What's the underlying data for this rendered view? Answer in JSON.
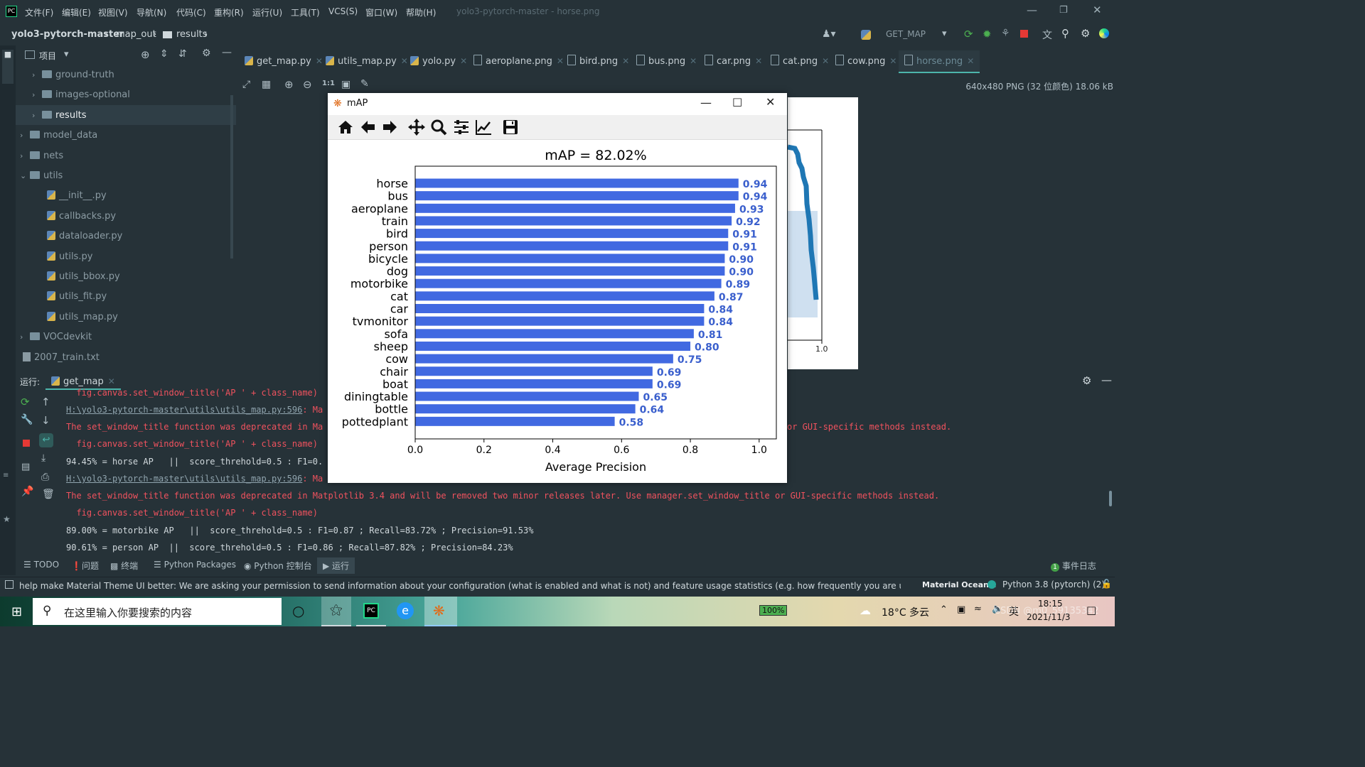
{
  "titlebar": {
    "menus": [
      "文件(F)",
      "编辑(E)",
      "视图(V)",
      "导航(N)",
      "代码(C)",
      "重构(R)",
      "运行(U)",
      "工具(T)",
      "VCS(S)",
      "窗口(W)",
      "帮助(H)"
    ],
    "title": "yolo3-pytorch-master - horse.png"
  },
  "breadcrumb": {
    "project": "yolo3-pytorch-master",
    "dir1": "map_out",
    "dir2": "results"
  },
  "run_config": "GET_MAP",
  "project_panel": {
    "label": "项目",
    "items": [
      {
        "name": "ground-truth",
        "type": "folder"
      },
      {
        "name": "images-optional",
        "type": "folder"
      },
      {
        "name": "results",
        "type": "folder"
      },
      {
        "name": "model_data",
        "type": "folder"
      },
      {
        "name": "nets",
        "type": "folder"
      },
      {
        "name": "utils",
        "type": "folder"
      },
      {
        "name": "__init__.py",
        "type": "py"
      },
      {
        "name": "callbacks.py",
        "type": "py"
      },
      {
        "name": "dataloader.py",
        "type": "py"
      },
      {
        "name": "utils.py",
        "type": "py"
      },
      {
        "name": "utils_bbox.py",
        "type": "py"
      },
      {
        "name": "utils_fit.py",
        "type": "py"
      },
      {
        "name": "utils_map.py",
        "type": "py"
      },
      {
        "name": "VOCdevkit",
        "type": "folder"
      },
      {
        "name": "2007_train.txt",
        "type": "txt"
      }
    ]
  },
  "tabs": [
    "get_map.py",
    "utils_map.py",
    "yolo.py",
    "aeroplane.png",
    "bird.png",
    "bus.png",
    "car.png",
    "cat.png",
    "cow.png",
    "horse.png"
  ],
  "image_info": "640x480 PNG (32 位颜色) 18.06 kB",
  "image_behind": {
    "tick": "1.0"
  },
  "run_panel": {
    "label": "运行:",
    "tab": "get_map",
    "lines": [
      {
        "text": "  fig.canvas.set_window_title('AP ' + class_name)",
        "style": "red"
      },
      {
        "text": "H:\\yolo3-pytorch-master\\utils\\utils_map.py:596",
        "style": "link",
        "suffix": ": Ma"
      },
      {
        "text": "The set_window_title function was deprecated in Ma",
        "style": "red",
        "right": "or GUI-specific methods instead."
      },
      {
        "text": "  fig.canvas.set_window_title('AP ' + class_name)",
        "style": "red"
      },
      {
        "text": "94.45% = horse AP   ||  score_threhold=0.5 : F1=0.",
        "style": "white"
      },
      {
        "text": "H:\\yolo3-pytorch-master\\utils\\utils_map.py:596",
        "style": "link",
        "suffix": ": Ma"
      },
      {
        "text": "The set_window_title function was deprecated in Matplotlib 3.4 and will be removed two minor releases later. Use manager.set_window_title or GUI-specific methods instead.",
        "style": "red"
      },
      {
        "text": "  fig.canvas.set_window_title('AP ' + class_name)",
        "style": "red"
      },
      {
        "text": "89.00% = motorbike AP   ||  score_threhold=0.5 : F1=0.87 ; Recall=83.72% ; Precision=91.53%",
        "style": "white"
      },
      {
        "text": "90.61% = person AP  ||  score_threhold=0.5 : F1=0.86 ; Recall=87.82% ; Precision=84.23%",
        "style": "white"
      }
    ]
  },
  "tool_tabs": [
    "TODO",
    "问题",
    "终端",
    "Python Packages",
    "Python 控制台",
    "运行"
  ],
  "event_log": "事件日志",
  "event_count": "1",
  "status": {
    "message": "help make Material Theme UI better: We are asking your permission to send information about your configuration (what is enabled and what is not) and feature usage statistics (e.g. how frequently you are using a feature).... (今",
    "theme": "Material Oceanic",
    "interpreter": "Python 3.8 (pytorch) (2)"
  },
  "taskbar": {
    "search_placeholder": "在这里输入你要搜索的内容",
    "battery": "100%",
    "weather": "18°C  多云",
    "ime": "英",
    "time": "18:15",
    "date": "2021/11/3",
    "watermark": "CSDN @m0_59135342"
  },
  "mpl_window": {
    "title": "mAP"
  },
  "chart_data": {
    "type": "bar",
    "orientation": "horizontal",
    "title": "mAP = 82.02%",
    "xlabel": "Average Precision",
    "ylabel": "",
    "xlim": [
      0,
      1.0
    ],
    "xticks": [
      "0.0",
      "0.2",
      "0.4",
      "0.6",
      "0.8",
      "1.0"
    ],
    "categories": [
      "horse",
      "bus",
      "aeroplane",
      "train",
      "bird",
      "person",
      "bicycle",
      "dog",
      "motorbike",
      "cat",
      "car",
      "tvmonitor",
      "sofa",
      "sheep",
      "cow",
      "chair",
      "boat",
      "diningtable",
      "bottle",
      "pottedplant"
    ],
    "values": [
      0.94,
      0.94,
      0.93,
      0.92,
      0.91,
      0.91,
      0.9,
      0.9,
      0.89,
      0.87,
      0.84,
      0.84,
      0.81,
      0.8,
      0.75,
      0.69,
      0.69,
      0.65,
      0.64,
      0.58
    ],
    "labels": [
      "0.94",
      "0.94",
      "0.93",
      "0.92",
      "0.91",
      "0.91",
      "0.90",
      "0.90",
      "0.89",
      "0.87",
      "0.84",
      "0.84",
      "0.81",
      "0.80",
      "0.75",
      "0.69",
      "0.69",
      "0.65",
      "0.64",
      "0.58"
    ],
    "bar_color": "#4169e1",
    "label_color": "#3a5fcd"
  }
}
